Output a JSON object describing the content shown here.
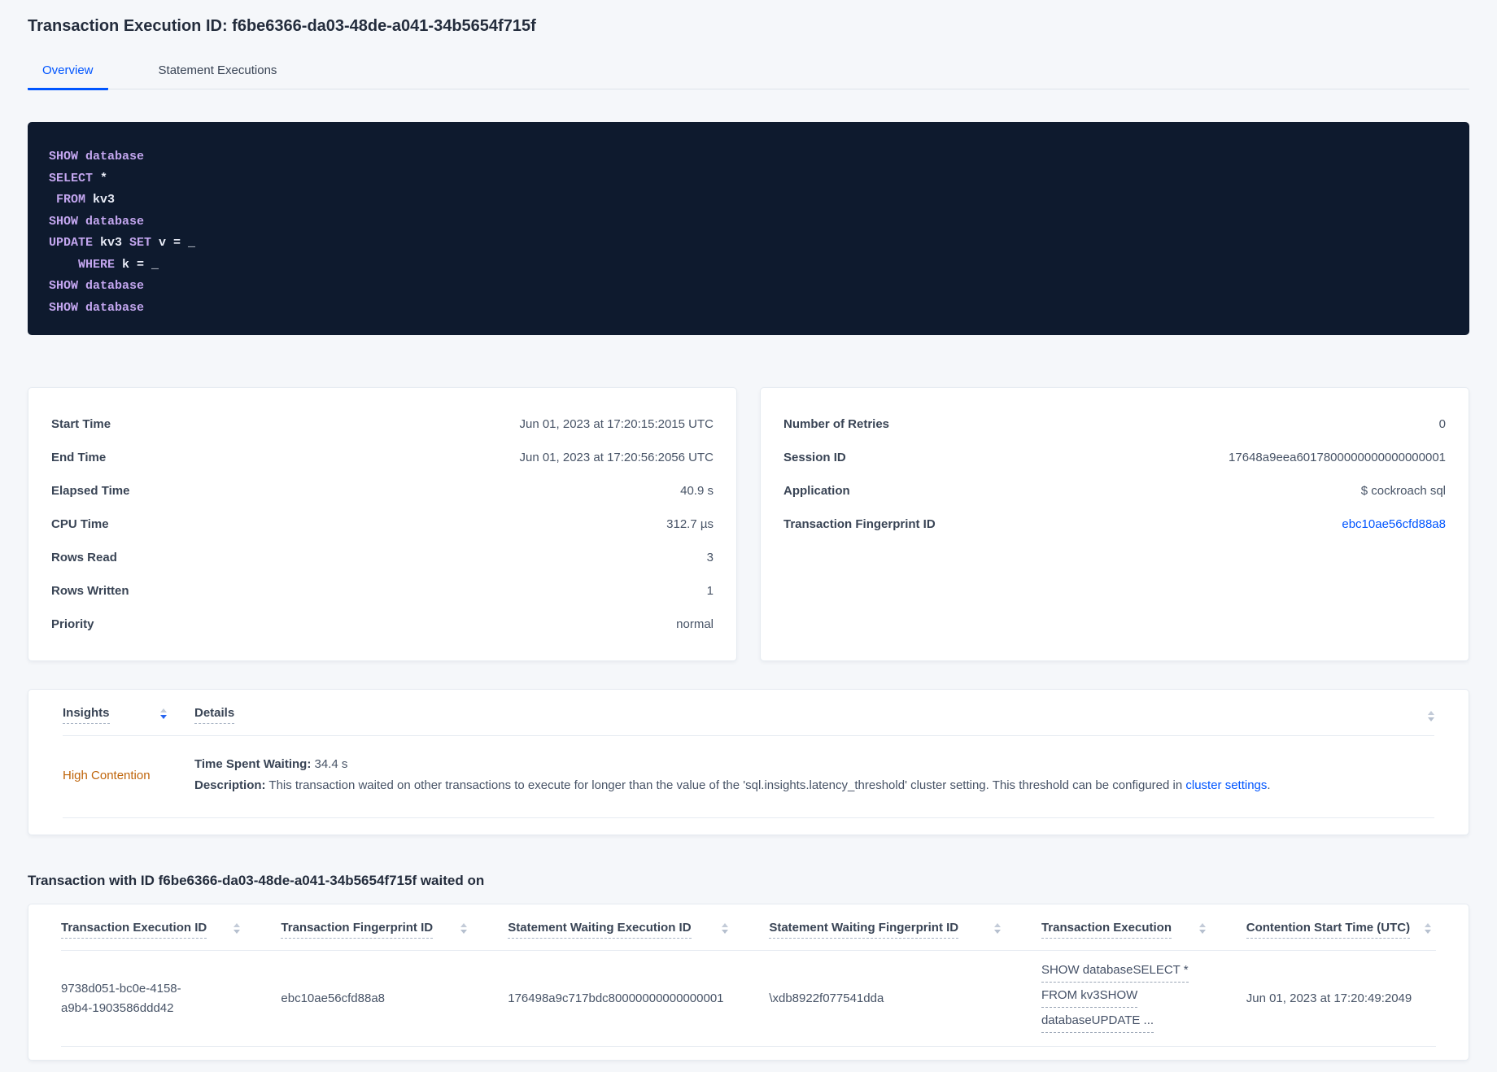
{
  "page": {
    "title": "Transaction Execution ID: f6be6366-da03-48de-a041-34b5654f715f"
  },
  "tabs": {
    "overview": "Overview",
    "statement_executions": "Statement Executions"
  },
  "colors": {
    "accent_blue": "#0055ff",
    "insight_warning": "#bf6409",
    "code_background": "#0e1a2e",
    "code_keyword": "#c3a6ef",
    "code_text": "#e9ecf7"
  },
  "sql": {
    "lines": [
      {
        "parts": [
          {
            "text": "SHOW database",
            "cls": "kw"
          }
        ]
      },
      {
        "parts": [
          {
            "text": "SELECT",
            "cls": "kw"
          },
          {
            "text": " *",
            "cls": "id"
          }
        ]
      },
      {
        "parts": [
          {
            "text": " ",
            "cls": "id"
          },
          {
            "text": "FROM",
            "cls": "kw"
          },
          {
            "text": " kv3",
            "cls": "id"
          }
        ]
      },
      {
        "parts": [
          {
            "text": "SHOW database",
            "cls": "kw"
          }
        ]
      },
      {
        "parts": [
          {
            "text": "UPDATE",
            "cls": "kw"
          },
          {
            "text": " kv3 ",
            "cls": "id"
          },
          {
            "text": "SET",
            "cls": "kw"
          },
          {
            "text": " v = _",
            "cls": "id"
          }
        ]
      },
      {
        "parts": [
          {
            "text": "    ",
            "cls": "id"
          },
          {
            "text": "WHERE",
            "cls": "kw"
          },
          {
            "text": " k = _",
            "cls": "id"
          }
        ]
      },
      {
        "parts": [
          {
            "text": "SHOW database",
            "cls": "kw"
          }
        ]
      },
      {
        "parts": [
          {
            "text": "SHOW database",
            "cls": "kw"
          }
        ]
      }
    ]
  },
  "summary_left": {
    "rows": [
      {
        "label": "Start Time",
        "value": "Jun 01, 2023 at 17:20:15:2015 UTC"
      },
      {
        "label": "End Time",
        "value": "Jun 01, 2023 at 17:20:56:2056 UTC"
      },
      {
        "label": "Elapsed Time",
        "value": "40.9 s"
      },
      {
        "label": "CPU Time",
        "value": "312.7 µs"
      },
      {
        "label": "Rows Read",
        "value": "3"
      },
      {
        "label": "Rows Written",
        "value": "1"
      },
      {
        "label": "Priority",
        "value": "normal"
      }
    ]
  },
  "summary_right": {
    "rows": [
      {
        "label": "Number of Retries",
        "value": "0"
      },
      {
        "label": "Session ID",
        "value": "17648a9eea6017800000000000000001"
      },
      {
        "label": "Application",
        "value": "$ cockroach sql"
      },
      {
        "label": "Transaction Fingerprint ID",
        "value": "ebc10ae56cfd88a8"
      }
    ]
  },
  "insights": {
    "col_insights": "Insights",
    "col_details": "Details",
    "row": {
      "insight": "High Contention",
      "waiting_label": "Time Spent Waiting:",
      "waiting_value": " 34.4 s",
      "desc_label": "Description:",
      "desc_text": " This transaction waited on other transactions to execute for longer than the value of the 'sql.insights.latency_threshold' cluster setting. This threshold can be configured in ",
      "desc_link": "cluster settings",
      "desc_suffix": "."
    }
  },
  "waited_on": {
    "heading": "Transaction with ID f6be6366-da03-48de-a041-34b5654f715f waited on",
    "columns": [
      "Transaction Execution ID",
      "Transaction Fingerprint ID",
      "Statement Waiting Execution ID",
      "Statement Waiting Fingerprint ID",
      "Transaction Execution",
      "Contention Start Time (UTC)"
    ],
    "row": {
      "transaction_execution_id": "9738d051-bc0e-4158-a9b4-1903586ddd42",
      "transaction_fingerprint_id": "ebc10ae56cfd88a8",
      "statement_waiting_execution_id": "176498a9c717bdc80000000000000001",
      "statement_waiting_fingerprint_id": "\\xdb8922f077541dda",
      "transaction_execution_lines": [
        "SHOW databaseSELECT *",
        "FROM kv3SHOW",
        "databaseUPDATE ..."
      ],
      "contention_start_time": "Jun 01, 2023 at 17:20:49:2049"
    }
  }
}
